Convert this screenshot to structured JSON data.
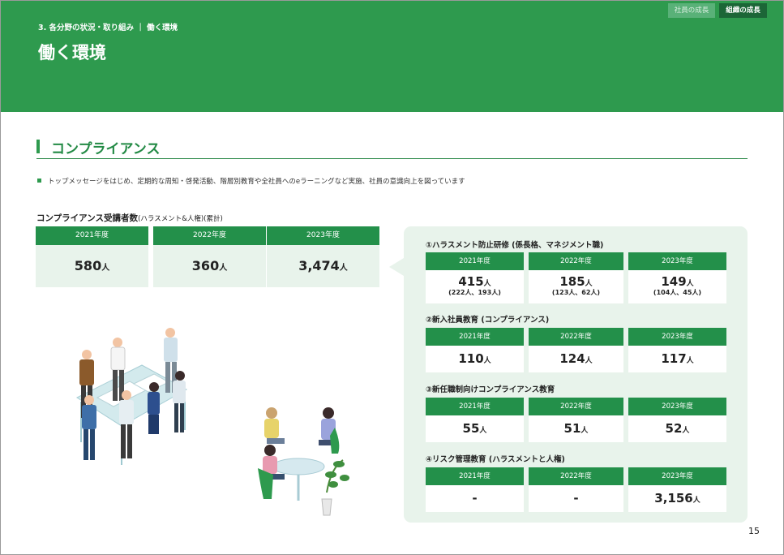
{
  "header": {
    "breadcrumb": "3. 各分野の状況・取り組み ｜ 働く環境",
    "title": "働く環境",
    "tabs": [
      {
        "label": "社員の成長",
        "active": false
      },
      {
        "label": "組織の成長",
        "active": true
      }
    ]
  },
  "section": {
    "title": "コンプライアンス",
    "bullet": "トップメッセージをはじめ、定期的な周知・啓発活動、階層別教育や全社員へのeラーニングなど実施、社員の意識向上を図っています"
  },
  "summary": {
    "title": "コンプライアンス受講者数",
    "title_sub": "(ハラスメント&人権)(累計)",
    "unit": "人",
    "years": [
      {
        "year": "2021年度",
        "value": "580"
      },
      {
        "year": "2022年度",
        "value": "360"
      },
      {
        "year": "2023年度",
        "value": "3,474"
      }
    ]
  },
  "groups": [
    {
      "title": "①ハラスメント防止研修 (係長格、マネジメント職)",
      "cells": [
        {
          "year": "2021年度",
          "value": "415",
          "unit": "人",
          "detail": "(222人、193人)"
        },
        {
          "year": "2022年度",
          "value": "185",
          "unit": "人",
          "detail": "(123人、62人)"
        },
        {
          "year": "2023年度",
          "value": "149",
          "unit": "人",
          "detail": "(104人、45人)"
        }
      ]
    },
    {
      "title": "②新入社員教育 (コンプライアンス)",
      "cells": [
        {
          "year": "2021年度",
          "value": "110",
          "unit": "人"
        },
        {
          "year": "2022年度",
          "value": "124",
          "unit": "人"
        },
        {
          "year": "2023年度",
          "value": "117",
          "unit": "人"
        }
      ]
    },
    {
      "title": "③新任職制向けコンプライアンス教育",
      "cells": [
        {
          "year": "2021年度",
          "value": "55",
          "unit": "人"
        },
        {
          "year": "2022年度",
          "value": "51",
          "unit": "人"
        },
        {
          "year": "2023年度",
          "value": "52",
          "unit": "人"
        }
      ]
    },
    {
      "title": "④リスク管理教育 (ハラスメントと人権)",
      "cells": [
        {
          "year": "2021年度",
          "value": "-",
          "unit": ""
        },
        {
          "year": "2022年度",
          "value": "-",
          "unit": ""
        },
        {
          "year": "2023年度",
          "value": "3,156",
          "unit": "人"
        }
      ]
    }
  ],
  "page_number": "15",
  "colors": {
    "brand_green": "#2e9a4e",
    "dark_green": "#1c6637",
    "panel_bg": "#e8f3eb"
  }
}
